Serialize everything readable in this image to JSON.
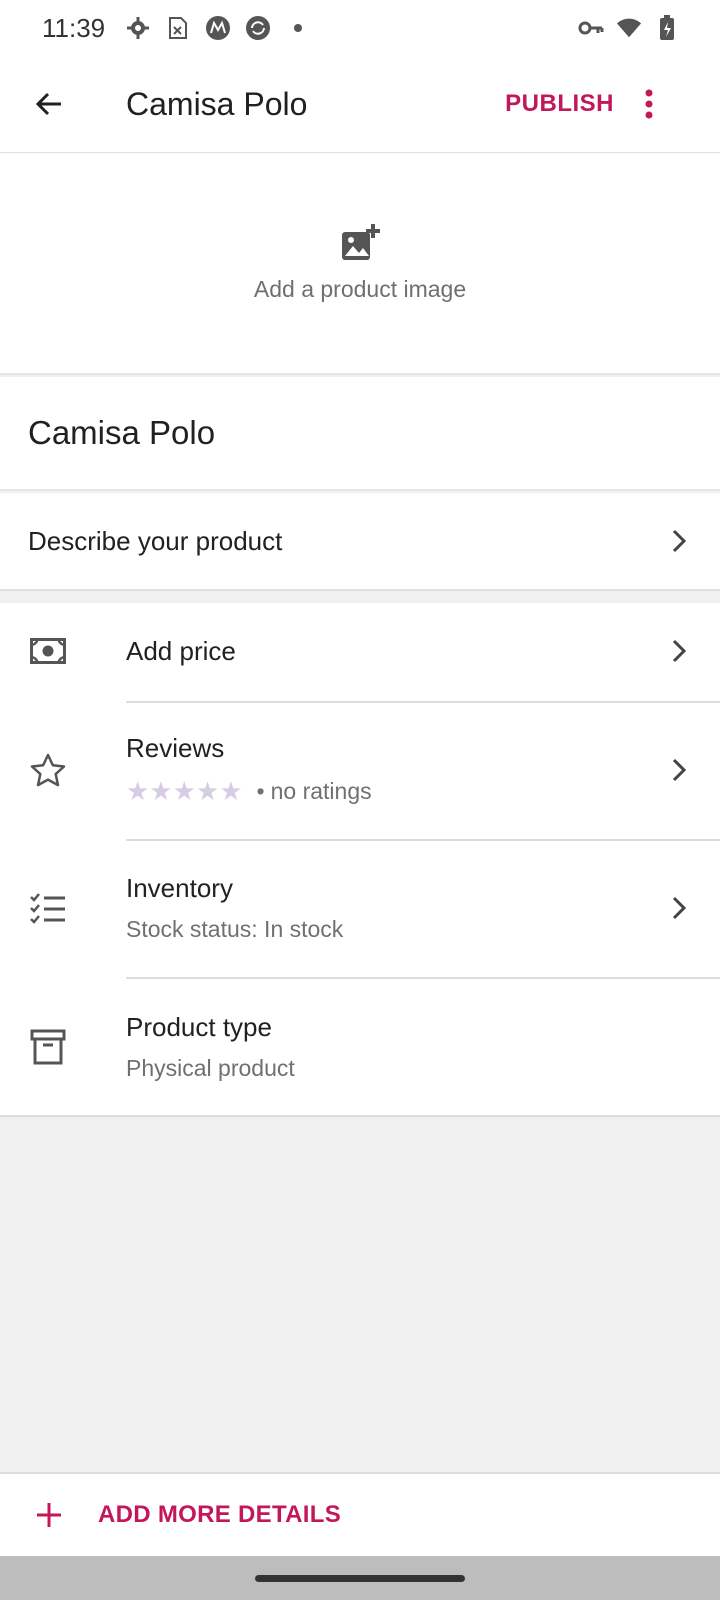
{
  "status_bar": {
    "time": "11:39",
    "icons_left": [
      "gear-icon",
      "sim-icon",
      "motorola-icon",
      "sync-icon",
      "dot-icon"
    ],
    "icons_right": [
      "key-icon",
      "wifi-icon",
      "battery-charging-icon"
    ]
  },
  "app_bar": {
    "title": "Camisa Polo",
    "publish_label": "PUBLISH",
    "accent_color": "#c2185b"
  },
  "image_section": {
    "caption": "Add a product image"
  },
  "product": {
    "name": "Camisa Polo",
    "describe_label": "Describe your product"
  },
  "details": {
    "price": {
      "title": "Add price",
      "icon": "money-icon"
    },
    "reviews": {
      "title": "Reviews",
      "rating_text": "no ratings",
      "stars": 0,
      "max_stars": 5,
      "icon": "star-outline-icon"
    },
    "inventory": {
      "title": "Inventory",
      "subtitle": "Stock status: In stock",
      "icon": "checklist-icon"
    },
    "product_type": {
      "title": "Product type",
      "subtitle": "Physical product",
      "icon": "archive-box-icon"
    }
  },
  "bottom": {
    "add_more_label": "ADD MORE DETAILS"
  }
}
